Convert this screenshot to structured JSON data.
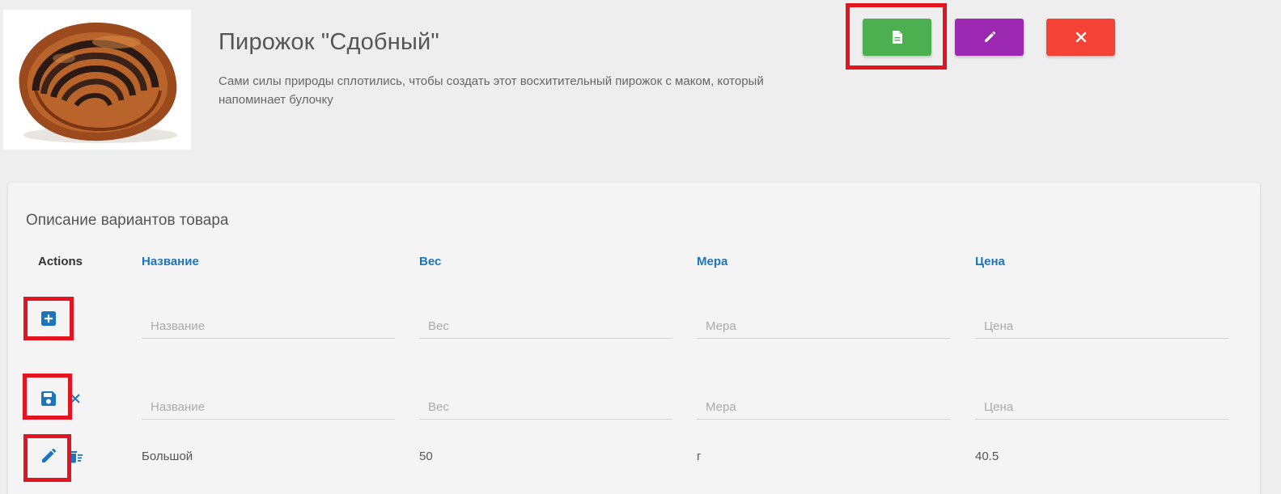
{
  "product": {
    "title": "Пирожок \"Сдобный\"",
    "description": "Сами силы природы сплотились, чтобы создать этот восхитительный пирожок с маком, который напоминает булочку"
  },
  "header_buttons": [
    {
      "name": "view",
      "icon": "document-icon",
      "color": "#4caf50"
    },
    {
      "name": "edit",
      "icon": "pencil-icon",
      "color": "#9c27b0"
    },
    {
      "name": "delete",
      "icon": "close-icon",
      "color": "#f44336"
    }
  ],
  "variants": {
    "title": "Описание вариантов товара",
    "columns": {
      "actions": "Actions",
      "name": "Название",
      "weight": "Вес",
      "measure": "Мера",
      "price": "Цена"
    },
    "new_row": {
      "name_placeholder": "Название",
      "weight_placeholder": "Вес",
      "measure_placeholder": "Мера",
      "price_placeholder": "Цена"
    },
    "edit_row": {
      "name_placeholder": "Название",
      "weight_placeholder": "Вес",
      "measure_placeholder": "Мера",
      "price_placeholder": "Цена"
    },
    "rows": [
      {
        "name": "Большой",
        "weight": "50",
        "measure": "г",
        "price": "40.5"
      }
    ]
  },
  "colors": {
    "accent": "#1c75bc",
    "highlight": "#e3141f"
  }
}
